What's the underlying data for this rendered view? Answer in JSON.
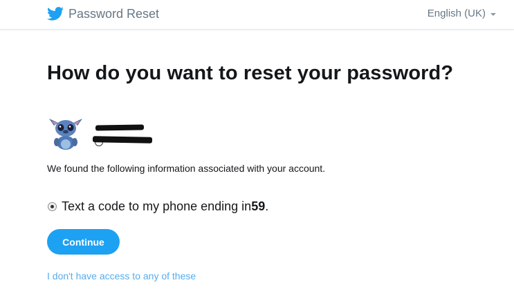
{
  "header": {
    "brand_icon": "twitter-bird-icon",
    "title": "Password Reset",
    "language": "English (UK)",
    "accent_color": "#1da1f2"
  },
  "main": {
    "heading": "How do you want to reset your password?",
    "account": {
      "avatar_icon": "stitch-avatar-image",
      "name_redacted": true,
      "handle_redacted": true
    },
    "info_text": "We found the following information associated with your account.",
    "options": [
      {
        "label_prefix": "Text a code to my phone ending in ",
        "phone_suffix": "59",
        "label_suffix": ".",
        "selected": true
      }
    ],
    "continue_label": "Continue",
    "no_access_link": "I don't have access to any of these"
  }
}
